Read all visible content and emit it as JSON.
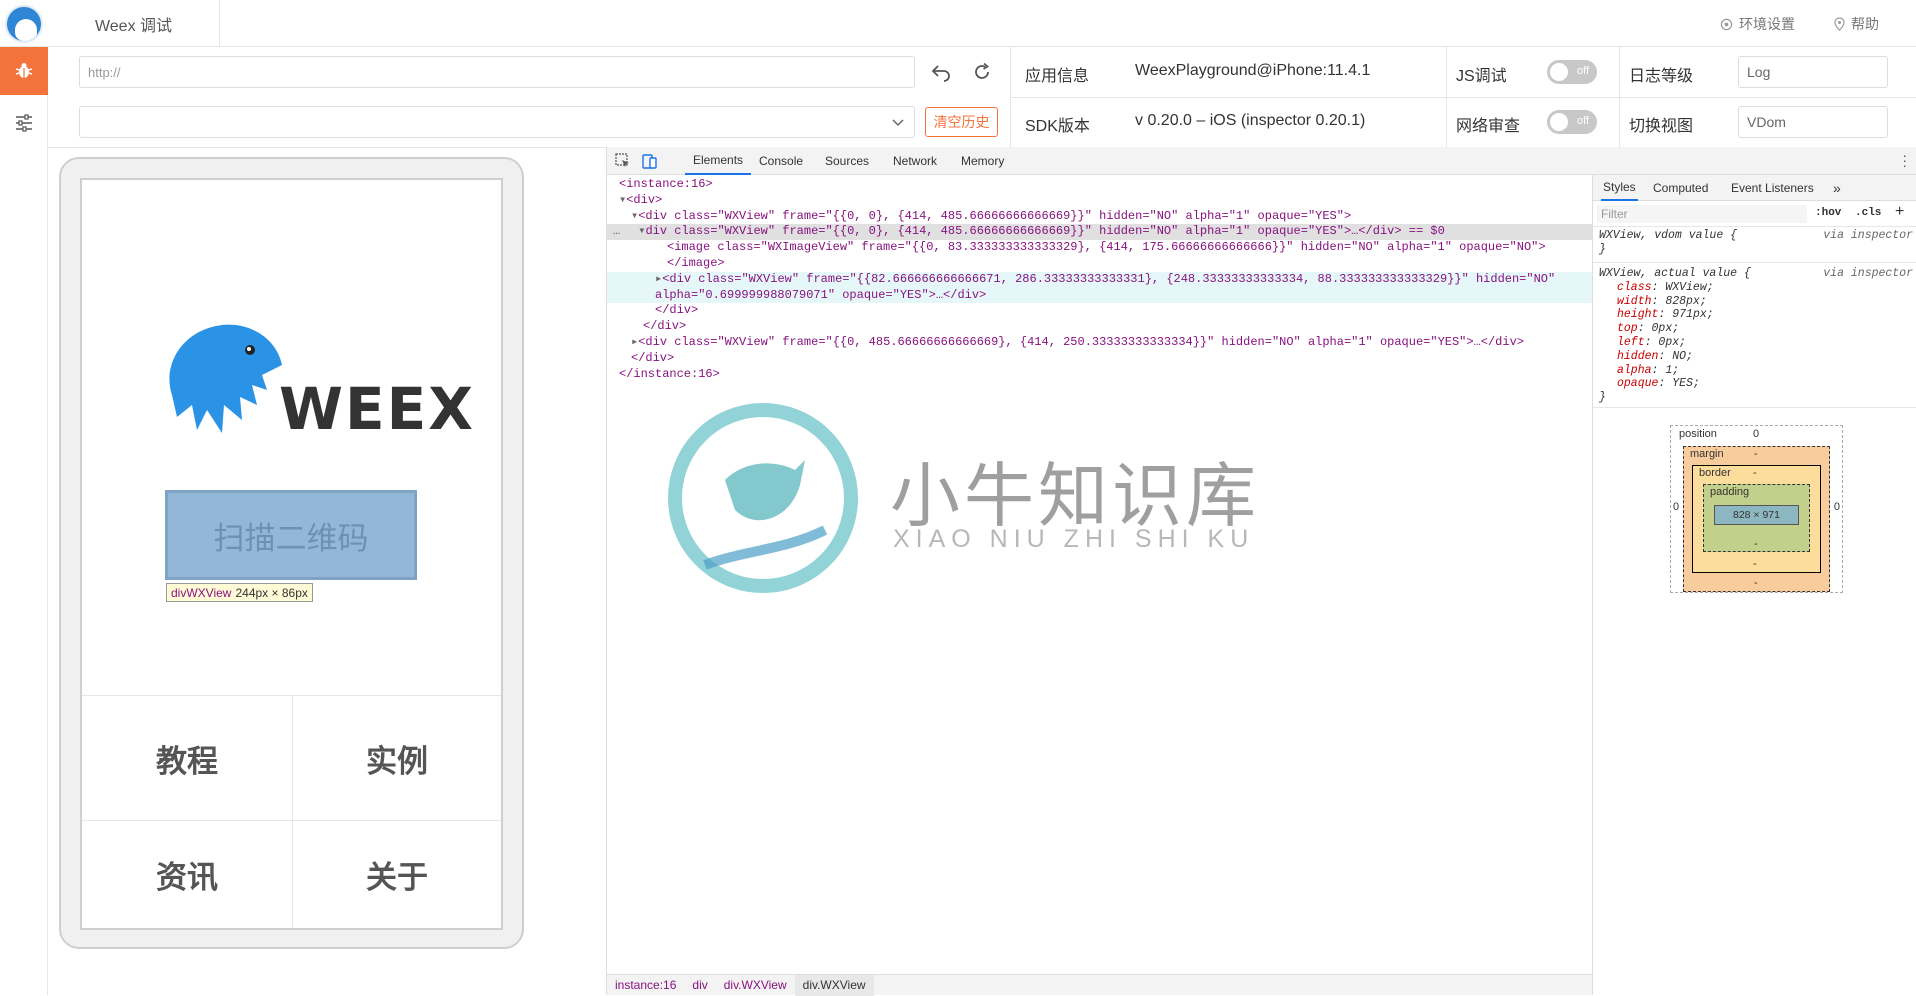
{
  "topbar": {
    "title": "Weex 调试",
    "env_settings": "环境设置",
    "help": "帮助"
  },
  "controls": {
    "url_placeholder": "http://",
    "clear_history": "清空历史",
    "app_info_label": "应用信息",
    "app_info_value": "WeexPlayground@iPhone:11.4.1",
    "sdk_label": "SDK版本",
    "sdk_value": "v 0.20.0 – iOS (inspector 0.20.1)",
    "js_debug_label": "JS调试",
    "js_debug_state": "off",
    "network_label": "网络审查",
    "network_state": "off",
    "log_level_label": "日志等级",
    "log_level_value": "Log",
    "view_label": "切换视图",
    "view_value": "VDom"
  },
  "phone": {
    "brand": "WEEX",
    "scan_button": "扫描二维码",
    "tooltip_tag": "divWXView",
    "tooltip_size": "244px × 86px",
    "grid": [
      "教程",
      "实例",
      "资讯",
      "关于"
    ]
  },
  "devtools": {
    "tabs": [
      "Elements",
      "Console",
      "Sources",
      "Network",
      "Memory"
    ],
    "active_tab": "Elements",
    "dom_lines": [
      "<instance:16>",
      "<div>",
      "<div class=\"WXView\" frame=\"{{0, 0}, {414, 485.66666666666669}}\" hidden=\"NO\" alpha=\"1\" opaque=\"YES\">",
      "div class=\"WXView\" frame=\"{{0, 0}, {414, 485.66666666666669}}\" hidden=\"NO\" alpha=\"1\" opaque=\"YES\">…</div> == $0",
      "<image class=\"WXImageView\" frame=\"{{0, 83.333333333333329}, {414, 175.66666666666666}}\" hidden=\"NO\" alpha=\"1\" opaque=\"NO\">",
      "</image>",
      "<div class=\"WXView\" frame=\"{{82.666666666666671, 286.33333333333331}, {248.33333333333334, 88.333333333333329}}\" hidden=\"NO\"",
      "alpha=\"0.699999988079071\" opaque=\"YES\">…</div>",
      "</div>",
      "</div>",
      "<div class=\"WXView\" frame=\"{{0, 485.66666666666669}, {414, 250.33333333333334}}\" hidden=\"NO\" alpha=\"1\" opaque=\"YES\">…</div>",
      "</div>",
      "</instance:16>"
    ],
    "breadcrumbs": [
      "instance:16",
      "div",
      "div.WXView",
      "div.WXView"
    ],
    "styles_tabs": [
      "Styles",
      "Computed",
      "Event Listeners",
      "»"
    ],
    "filter_placeholder": "Filter",
    "hov": ":hov",
    "cls": ".cls",
    "plus": "+",
    "vdom_header": "WXView, vdom value {",
    "via": "via inspector",
    "close_brace": "}",
    "actual_header": "WXView, actual value {",
    "actual_props": [
      [
        "class",
        "WXView;"
      ],
      [
        "width",
        "828px;"
      ],
      [
        "height",
        "971px;"
      ],
      [
        "top",
        "0px;"
      ],
      [
        "left",
        "0px;"
      ],
      [
        "hidden",
        "NO;"
      ],
      [
        "alpha",
        "1;"
      ],
      [
        "opaque",
        "YES;"
      ]
    ],
    "box_model": {
      "position_label": "position",
      "position_value": "0",
      "margin_label": "margin",
      "border_label": "border",
      "padding_label": "padding",
      "content_size": "828 × 971",
      "dash": "-",
      "zero": "0"
    }
  },
  "watermark": {
    "cn": "小牛知识库",
    "en": "XIAO NIU ZHI SHI KU"
  }
}
